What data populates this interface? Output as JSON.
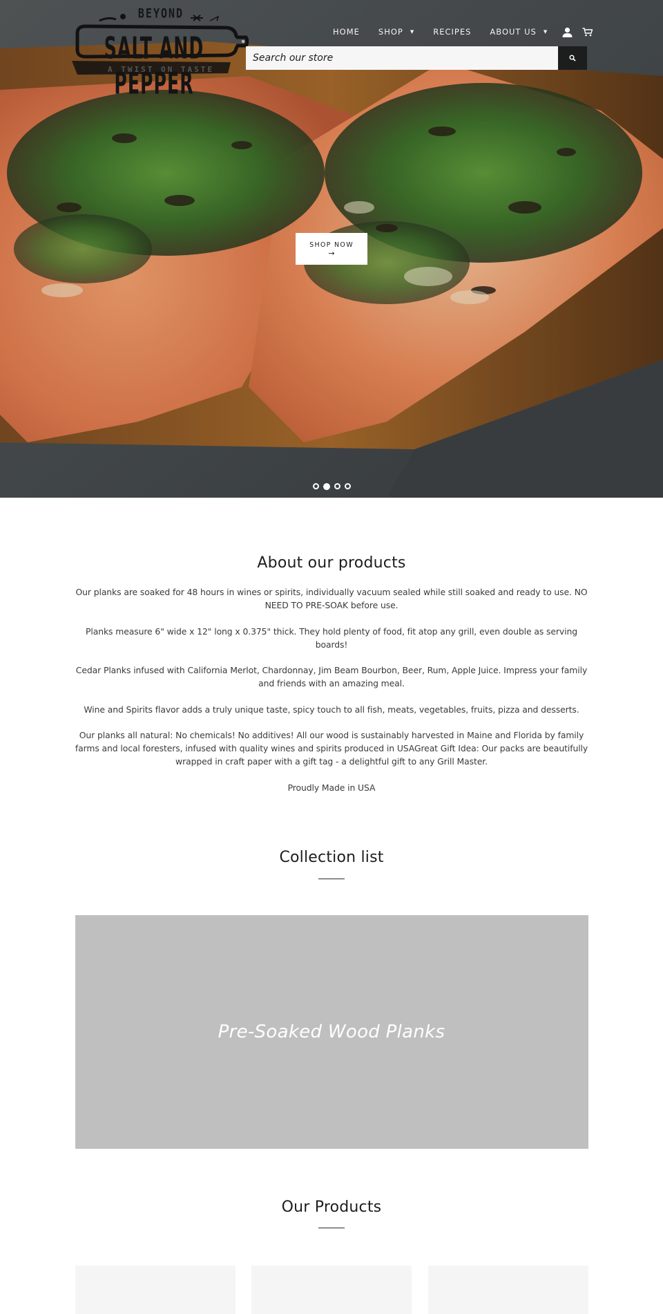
{
  "brand": {
    "logo_top": "BEYOND",
    "logo_main": "SALT AND PEPPER",
    "logo_tagline": "A TWIST ON TASTE"
  },
  "nav": {
    "items": [
      {
        "label": "HOME",
        "has_dropdown": false
      },
      {
        "label": "SHOP",
        "has_dropdown": true
      },
      {
        "label": "RECIPES",
        "has_dropdown": false
      },
      {
        "label": "ABOUT US",
        "has_dropdown": true
      }
    ],
    "account_icon": "user-icon",
    "cart_icon": "cart-icon",
    "caret": "▼"
  },
  "search": {
    "placeholder": "Search our store",
    "value": "",
    "button_icon": "search-icon"
  },
  "hero": {
    "cta_label": "SHOP NOW",
    "cta_arrow": "→",
    "slides_total": 4,
    "active_slide": 2
  },
  "about": {
    "title": "About our products",
    "paragraphs": [
      "Our planks are soaked for 48 hours in wines or spirits, individually vacuum sealed while still soaked and ready to use. NO NEED TO PRE-SOAK before use.",
      "Planks measure 6\" wide x 12\" long x 0.375\" thick. They hold plenty of food, fit atop any grill, even double as serving boards!",
      "Cedar Planks infused with California Merlot, Chardonnay, Jim Beam Bourbon, Beer, Rum, Apple Juice. Impress your family and friends with an amazing meal.",
      "Wine and Spirits flavor adds a truly unique taste, spicy touch to all fish, meats, vegetables, fruits, pizza and desserts.",
      "Our planks all natural: No chemicals! No additives! All our wood is sustainably harvested in Maine and Florida by family farms and local foresters, infused with quality wines and spirits produced in USAGreat Gift Idea: Our packs are beautifully wrapped in craft paper with a gift tag - a delightful gift to any Grill Master.",
      "Proudly Made in USA"
    ]
  },
  "collection": {
    "title": "Collection list",
    "items": [
      {
        "title": "Pre-Soaked Wood Planks"
      }
    ]
  },
  "products": {
    "title": "Our Products",
    "items": [
      {},
      {},
      {}
    ]
  },
  "colors": {
    "text": "#1c1d1d",
    "body_text": "#3a3a3a",
    "search_bg": "#f6f6f6",
    "search_button": "#1c1d1d",
    "collection_placeholder": "#bfbfbf",
    "product_placeholder": "#f5f5f5"
  }
}
